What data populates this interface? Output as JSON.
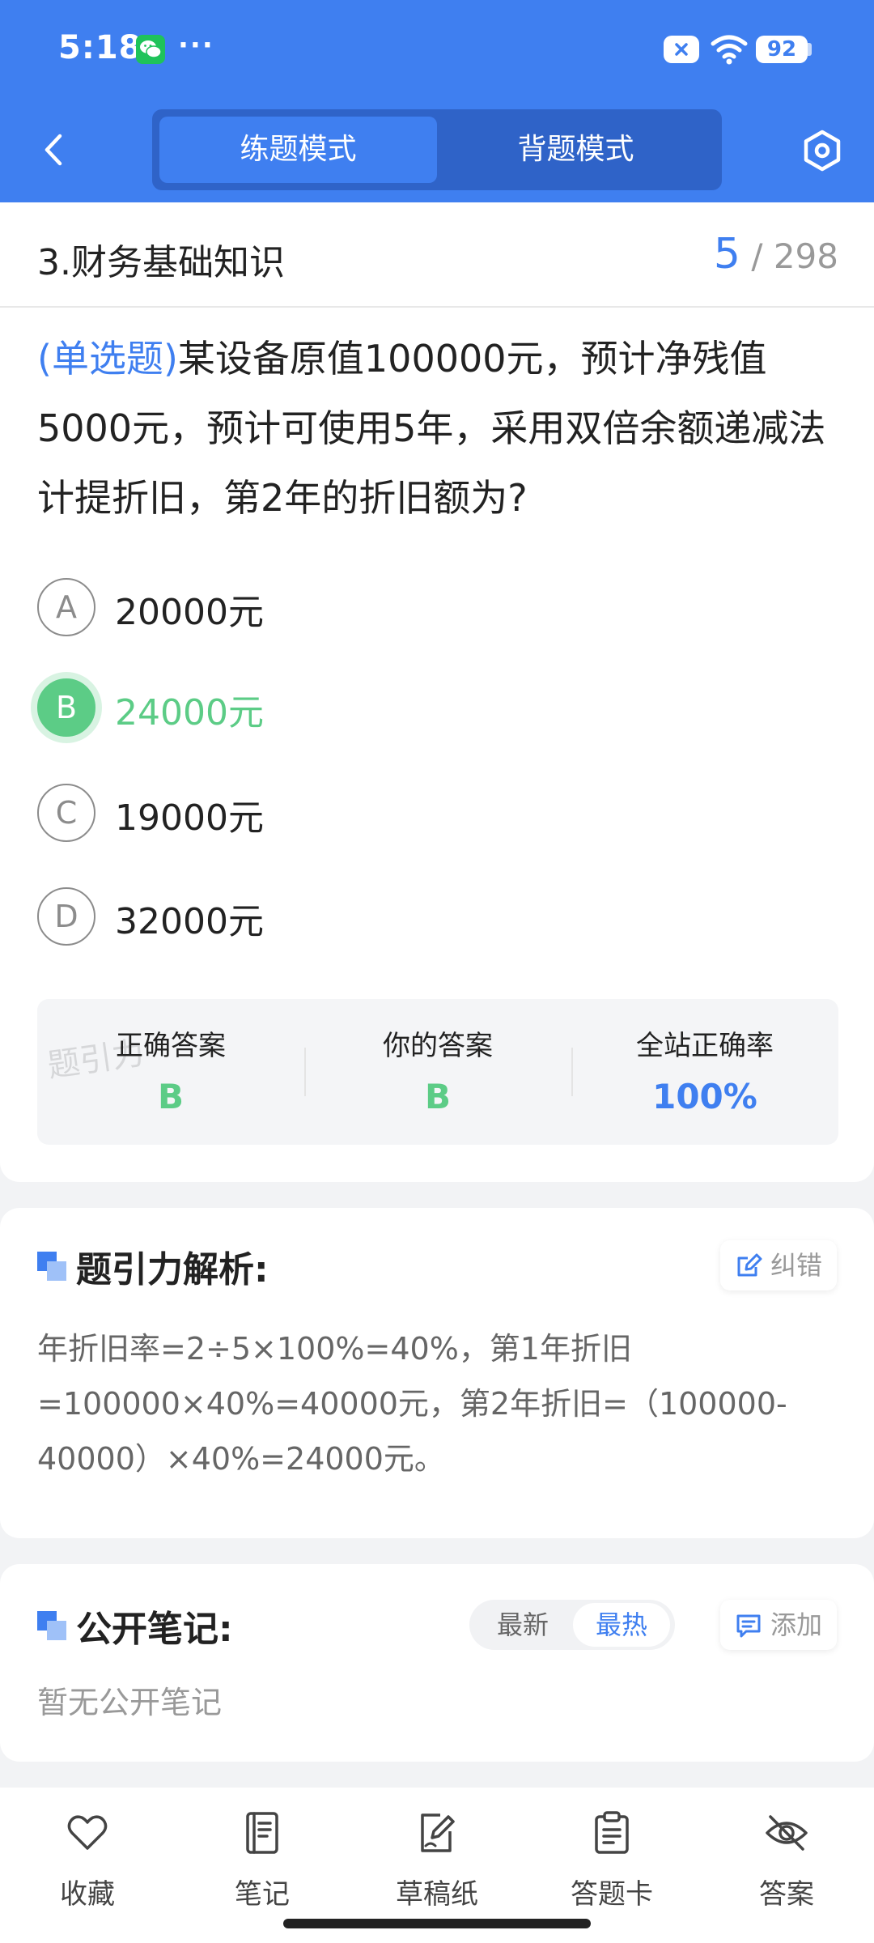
{
  "status_bar": {
    "time": "5:18",
    "dots": "···",
    "battery": "92",
    "icons": [
      "wechat-icon",
      "sim-x-icon",
      "wifi-icon",
      "battery-icon"
    ]
  },
  "nav": {
    "back_icon": "chevron-left-icon",
    "mode_tabs": [
      "练题模式",
      "背题模式"
    ],
    "active_tab": "练题模式",
    "settings_icon": "settings-hexagon-icon"
  },
  "chapter": {
    "title": "3.财务基础知识",
    "current": "5",
    "total": "/ 298"
  },
  "question": {
    "type": "(单选题)",
    "text": "某设备原值100000元，预计净残值5000元，预计可使用5年，采用双倍余额递减法计提折旧，第2年的折旧额为?",
    "options": [
      {
        "letter": "A",
        "text": "20000元",
        "correct": false
      },
      {
        "letter": "B",
        "text": "24000元",
        "correct": true
      },
      {
        "letter": "C",
        "text": "19000元",
        "correct": false
      },
      {
        "letter": "D",
        "text": "32000元",
        "correct": false
      }
    ]
  },
  "answer": {
    "watermark": "题引力",
    "correct_label": "正确答案",
    "correct_value": "B",
    "yours_label": "你的答案",
    "yours_value": "B",
    "rate_label": "全站正确率",
    "rate_value": "100%"
  },
  "analysis": {
    "title": "题引力解析:",
    "report_label": "纠错",
    "text": "年折旧率=2÷5×100%=40%，第1年折旧=100000×40%=40000元，第2年折旧=（100000-40000）×40%=24000元。"
  },
  "notes": {
    "title": "公开笔记:",
    "sort_latest": "最新",
    "sort_hot": "最热",
    "add_label": "添加",
    "empty": "暂无公开笔记"
  },
  "bottom_bar": {
    "items": [
      {
        "label": "收藏",
        "icon": "heart-icon"
      },
      {
        "label": "笔记",
        "icon": "notebook-icon"
      },
      {
        "label": "草稿纸",
        "icon": "draft-pen-icon"
      },
      {
        "label": "答题卡",
        "icon": "clipboard-icon"
      },
      {
        "label": "答案",
        "icon": "eye-off-icon"
      }
    ]
  },
  "colors": {
    "primary": "#3f7ff0",
    "correct": "#5ccc86",
    "muted": "#999999"
  }
}
